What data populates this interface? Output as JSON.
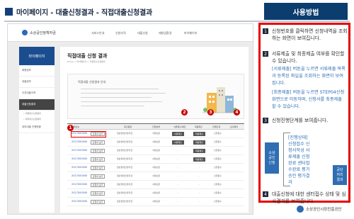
{
  "header": {
    "title": "마이페이지 - 대출신청결과 - 직접대출신청결과",
    "side_tab": "사용방법"
  },
  "site": {
    "logo_text": "소상공인정책자금",
    "nav": [
      "서비스안내",
      "신청자격",
      "대출신청",
      "재창업환경",
      "마이페이지"
    ],
    "sidebar_title": "마이페이지",
    "sidebar_items": [
      "회원정보",
      "대출정보",
      "이전대출이력",
      "대출신청결과"
    ],
    "sidebar_subs": [
      "• 직접대출신청결과",
      "• 대리대출신청결과"
    ],
    "sidebar_extra": "대리대출 진행현황",
    "page_title": "직접대출 신청 결과",
    "breadcrumb": "Home > 마이페이지 > 직접대출신청결과",
    "notice_title": "직접대출 신청결과 안내",
    "table_headers": [
      "신청번호",
      "",
      "대출종류",
      "진행상태",
      "서류제출/확인",
      "최종제출",
      "진행단계",
      "심사결과"
    ],
    "rows": [
      {
        "no": "2017000000",
        "btn": "신청서 보기",
        "kind": "일반경영안정자금",
        "status": "서류보완",
        "a": "서류제출",
        "b": "최종제출",
        "c": "신청접수"
      },
      {
        "no": "2017000000",
        "btn": "신청서 보기",
        "kind": "일반경영안정자금",
        "status": "서류보완",
        "a": "서류제출",
        "b": "최종제출",
        "c": "신청접수"
      },
      {
        "no": "2017000000",
        "btn": "신청서 보기",
        "kind": "일반경영안정자금",
        "status": "서류보완",
        "a": "-",
        "b": "최종제출",
        "c": "신청접수"
      },
      {
        "no": "2017000000",
        "btn": "신청서 보기",
        "kind": "일반경영안정자금",
        "status": "서류보완",
        "a": "-",
        "b": "최종제출",
        "c": "신청접수"
      },
      {
        "no": "2017000000",
        "btn": "신청서 보기",
        "kind": "일반경영안정자금",
        "status": "서류보완",
        "a": "-",
        "b": "-",
        "c": "신청접수"
      },
      {
        "no": "2017000000",
        "btn": "신청서 보기",
        "kind": "일반경영안정자금",
        "status": "서류보완",
        "a": "-",
        "b": "-",
        "c": "신청접수"
      },
      {
        "no": "2017000000",
        "btn": "신청서 보기",
        "kind": "일반경영안정자금",
        "status": "서류보완",
        "a": "-",
        "b": "-",
        "c": "신청접수"
      },
      {
        "no": "2017000000",
        "btn": "신청서 보기",
        "kind": "일반경영안정자금",
        "status": "서류보완",
        "a": "-",
        "b": "-",
        "c": "신청접수"
      },
      {
        "no": "2017000000",
        "btn": "신청서 보기",
        "kind": "일반경영안정자금",
        "status": "서류보완",
        "a": "-",
        "b": "-",
        "c": "신청접수"
      }
    ],
    "badges": [
      "1",
      "2",
      "3",
      "4"
    ]
  },
  "instructions": {
    "steps": [
      {
        "num": "1",
        "text": "신청번호를 클릭하면 신청내역을 조회하는 화면이 보여집니다."
      },
      {
        "num": "2",
        "text": "서류제출 및 최종제출 여부를 확인할 수 있습니다."
      },
      {
        "num": "3",
        "text": "신청진행단계를 보여줍니다."
      },
      {
        "num": "4",
        "text": "대출신청에 대한 센터접수 상태 및 심사결과를 보여줍니다."
      }
    ],
    "note_docs": "[서류제출] 버튼을 누르면 서류제출 목록과 등록된 파일을 조회하는 화면이 보여집니다.",
    "note_final": "[최종제출] 버튼을 누르면 STEP04신청화면으로 이동하며, 신청서를 최종제출 할 수 있습니다.",
    "flow": {
      "left_label": [
        "소상",
        "공인",
        "신청"
      ],
      "title": "[진행상태]",
      "lines": [
        "신청접수 신",
        "청서작성 서",
        "류제출 신청",
        "완료 센터접",
        "수완료 평가",
        "승인 평가결",
        "과"
      ],
      "right_label": [
        "공단",
        "처리",
        "결과"
      ]
    }
  },
  "footer": {
    "logo_text": "소상공인시장진흥공단"
  },
  "colors": {
    "accent_red": "#e60000",
    "navy": "#0b3d6e",
    "blue_text": "#2e6db5"
  }
}
